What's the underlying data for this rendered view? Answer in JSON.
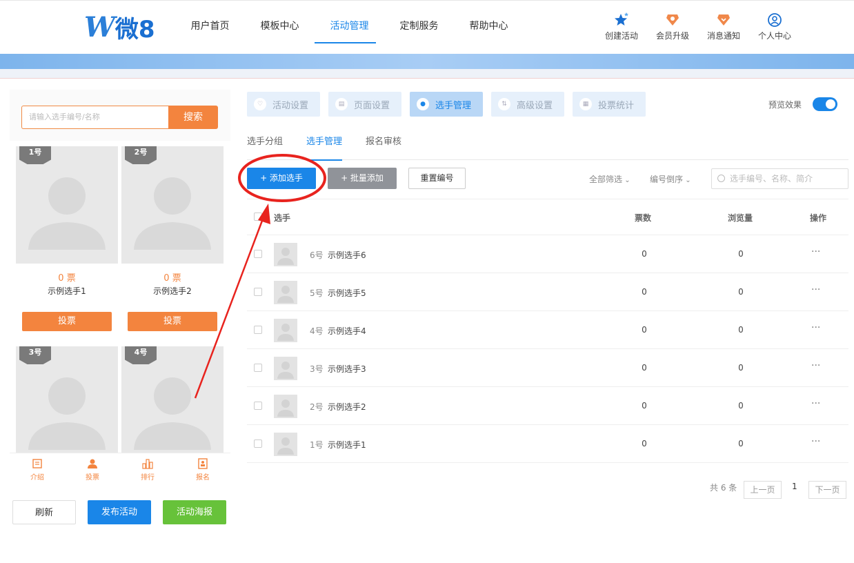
{
  "header": {
    "logo_w": "W",
    "logo_rest": "微8",
    "nav": [
      "用户首页",
      "模板中心",
      "活动管理",
      "定制服务",
      "帮助中心"
    ],
    "nav_active": 2,
    "icons": [
      {
        "label": "创建活动",
        "icon": "star-icon"
      },
      {
        "label": "会员升级",
        "icon": "member-badge-icon"
      },
      {
        "label": "消息通知",
        "icon": "message-badge-icon"
      },
      {
        "label": "个人中心",
        "icon": "user-icon"
      }
    ]
  },
  "preview": {
    "search_placeholder": "请输入选手编号/名称",
    "search_button": "搜索",
    "cards": [
      {
        "tag": "1号",
        "votes": "0 票",
        "name": "示例选手1",
        "button": "投票"
      },
      {
        "tag": "2号",
        "votes": "0 票",
        "name": "示例选手2",
        "button": "投票"
      },
      {
        "tag": "3号"
      },
      {
        "tag": "4号"
      }
    ],
    "bottom_bar": [
      "介绍",
      "投票",
      "排行",
      "报名"
    ]
  },
  "left_buttons": {
    "refresh": "刷新",
    "publish": "发布活动",
    "poster": "活动海报"
  },
  "top_tabs": [
    "活动设置",
    "页面设置",
    "选手管理",
    "高级设置",
    "投票统计"
  ],
  "top_tab_active": 2,
  "preview_label": "预览效果",
  "preview_toggle_on": true,
  "sub_tabs": [
    "选手分组",
    "选手管理",
    "报名审核"
  ],
  "sub_tab_active": 1,
  "toolbar": {
    "add": "+ 添加选手",
    "batch": "+ 批量添加",
    "reset": "重置编号",
    "filter": "全部筛选",
    "sort": "编号倒序",
    "search_placeholder": "选手编号、名称、简介"
  },
  "table": {
    "headers": [
      "选手",
      "票数",
      "浏览量",
      "操作"
    ],
    "rows": [
      {
        "num": "6号",
        "name": "示例选手6",
        "votes": "0",
        "views": "0",
        "op": "···"
      },
      {
        "num": "5号",
        "name": "示例选手5",
        "votes": "0",
        "views": "0",
        "op": "···"
      },
      {
        "num": "4号",
        "name": "示例选手4",
        "votes": "0",
        "views": "0",
        "op": "···"
      },
      {
        "num": "3号",
        "name": "示例选手3",
        "votes": "0",
        "views": "0",
        "op": "···"
      },
      {
        "num": "2号",
        "name": "示例选手2",
        "votes": "0",
        "views": "0",
        "op": "···"
      },
      {
        "num": "1号",
        "name": "示例选手1",
        "votes": "0",
        "views": "0",
        "op": "···"
      }
    ]
  },
  "pagination": {
    "total": "共 6 条",
    "prev": "上一页",
    "page": "1",
    "next": "下一页"
  },
  "colors": {
    "primary": "#1a86e8",
    "orange": "#f3843e",
    "green": "#67c23a",
    "annotation": "#e8231e"
  }
}
